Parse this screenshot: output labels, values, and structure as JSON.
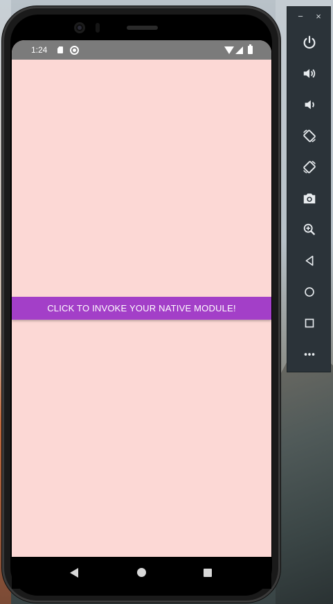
{
  "status_bar": {
    "time": "1:24",
    "icons": [
      "sd-card-icon",
      "sync-icon",
      "wifi-icon",
      "signal-icon",
      "battery-icon"
    ]
  },
  "app": {
    "background_color": "#fcd8d5",
    "button": {
      "label": "CLICK TO INVOKE YOUR NATIVE MODULE!",
      "color": "#a33fc8"
    }
  },
  "navigation_bar": {
    "buttons": [
      "back-icon",
      "home-icon",
      "recents-icon"
    ]
  },
  "emulator_toolbar": {
    "window_controls": {
      "minimize": "−",
      "close": "×"
    },
    "buttons": [
      "power-icon",
      "volume-up-icon",
      "volume-down-icon",
      "rotate-left-icon",
      "rotate-right-icon",
      "camera-icon",
      "zoom-icon",
      "back-icon",
      "home-icon",
      "overview-icon",
      "more-icon"
    ]
  }
}
